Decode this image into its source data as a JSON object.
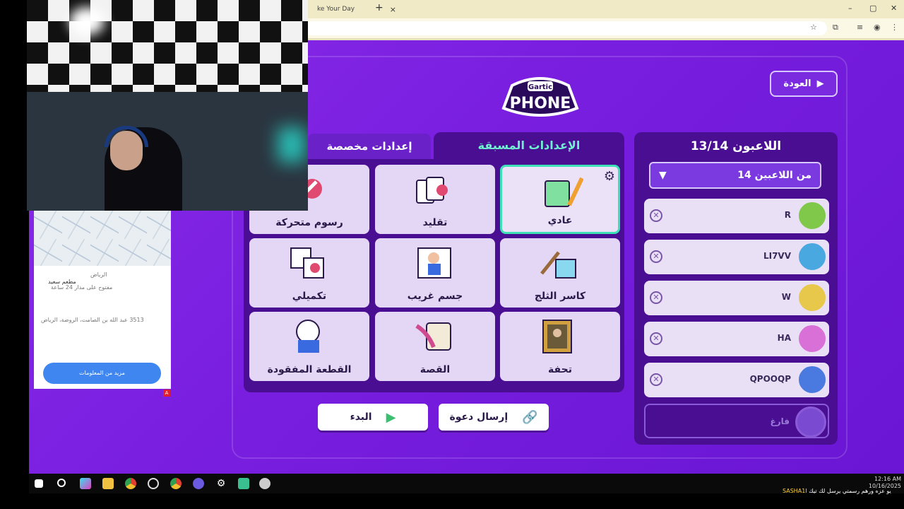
{
  "browser": {
    "tab_title": "ke Your Day",
    "tab_close": "×",
    "new_tab": "+",
    "minimize": "–",
    "maximize": "▢",
    "close": "✕"
  },
  "game": {
    "back_label": "العودة",
    "players_title": "اللاعبون 13/14",
    "player_limit": "14 من اللاعبين",
    "players": [
      {
        "name": "R",
        "avatar_color": "#7fc84a"
      },
      {
        "name": "LI7VV",
        "avatar_color": "#4aa8e0"
      },
      {
        "name": "W",
        "avatar_color": "#e8c84a"
      },
      {
        "name": "HA",
        "avatar_color": "#d870d8"
      },
      {
        "name": "QPOOQP",
        "avatar_color": "#4a7ae0"
      }
    ],
    "empty_slot": "فارغ",
    "tab_presets": "الإعدادات المسبقة",
    "tab_custom": "إعدادات مخصصة",
    "modes": [
      {
        "label": "عادي",
        "icon": "notepad-pencil-icon"
      },
      {
        "label": "تقليد",
        "icon": "cards-icon"
      },
      {
        "label": "رسوم متحركة",
        "icon": "animation-icon"
      },
      {
        "label": "كاسر الثلج",
        "icon": "ice-hammer-icon"
      },
      {
        "label": "جسم غريب",
        "icon": "strange-body-icon"
      },
      {
        "label": "تكميلي",
        "icon": "puzzle-icon"
      },
      {
        "label": "تحفة",
        "icon": "masterpiece-icon"
      },
      {
        "label": "القصة",
        "icon": "scroll-quill-icon"
      },
      {
        "label": "القطعة المفقودة",
        "icon": "missing-piece-icon"
      }
    ],
    "invite_label": "إرسال دعوة",
    "start_label": "البدء",
    "gear": "⚙"
  },
  "map_card": {
    "place": "الرياض",
    "subtitle": "مطعم سعيد",
    "hours": "مفتوح على مدار 24 ساعة",
    "address": "3513 عبد الله بن الصامت، الروضة، الرياض",
    "more_button": "مزيد من المعلومات",
    "badge": "A"
  },
  "taskbar": {
    "time": "12:16 AM",
    "date": "10/16/2025",
    "ticker_user": "SASHA1I",
    "ticker_msg": "يو عزه ورهم رسمتي يرسل لك تيك"
  }
}
